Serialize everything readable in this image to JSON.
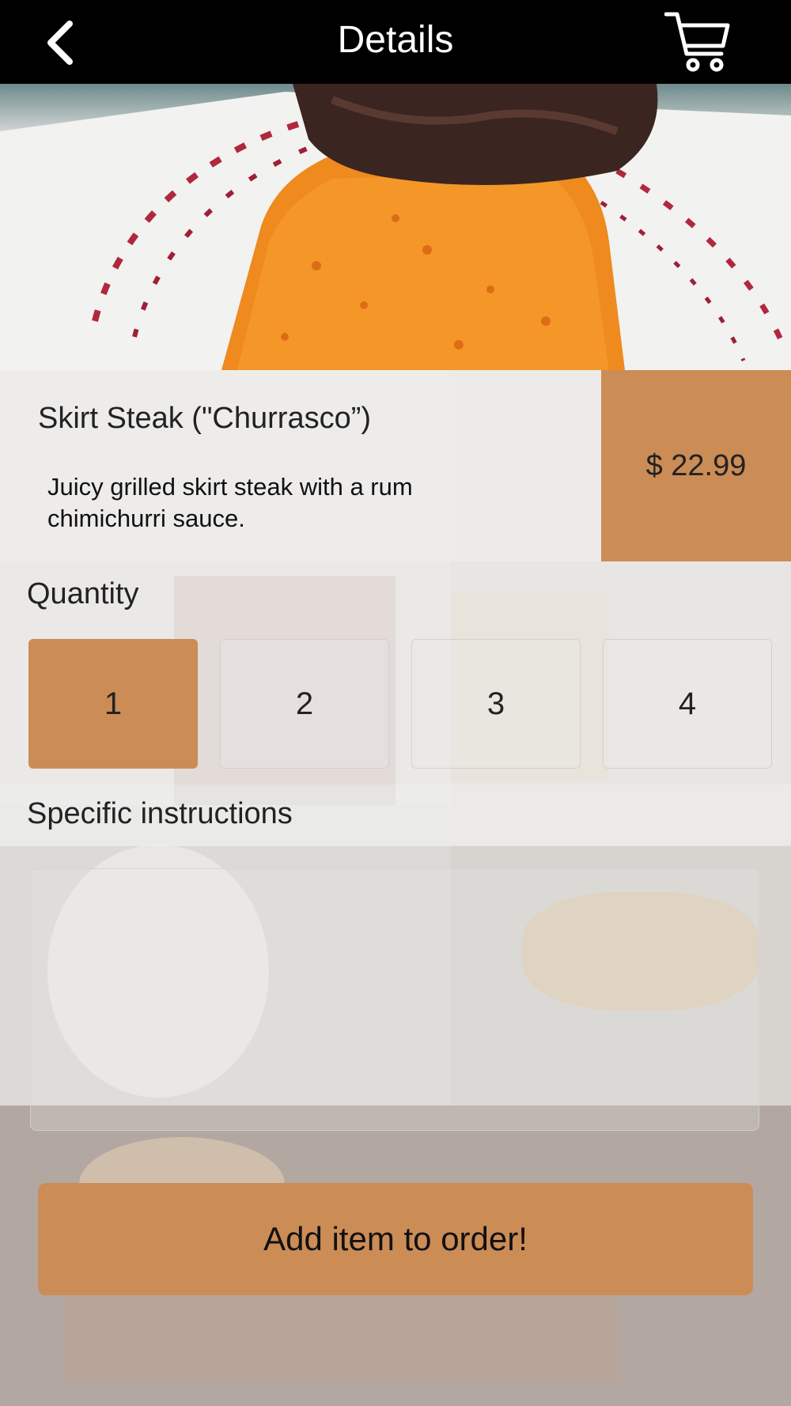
{
  "header": {
    "title": "Details",
    "back_icon": "chevron-left-icon",
    "cart_icon": "cart-icon"
  },
  "item": {
    "name": "Skirt Steak (\"Churrasco”)",
    "description": "Juicy grilled skirt steak with a rum chimichurri sauce.",
    "price": "$ 22.99"
  },
  "quantity": {
    "label": "Quantity",
    "options": [
      "1",
      "2",
      "3",
      "4"
    ],
    "selected": "1"
  },
  "instructions": {
    "label": "Specific instructions",
    "value": ""
  },
  "actions": {
    "add_label": "Add item to order!"
  },
  "colors": {
    "accent": "#cc8c56",
    "header_bg": "#000000"
  }
}
